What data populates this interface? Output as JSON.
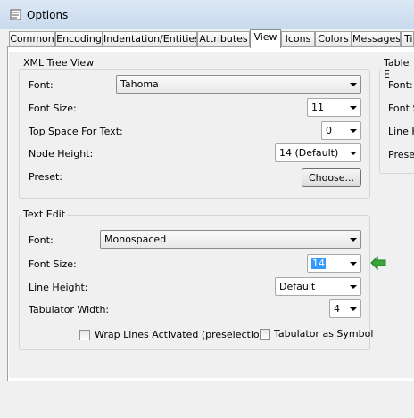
{
  "window": {
    "title": "Options"
  },
  "tabs": [
    {
      "label": "Common"
    },
    {
      "label": "Encoding"
    },
    {
      "label": "Indentation/Entities"
    },
    {
      "label": "Attributes"
    },
    {
      "label": "View"
    },
    {
      "label": "Icons"
    },
    {
      "label": "Colors"
    },
    {
      "label": "Messages"
    },
    {
      "label": "Ti"
    }
  ],
  "xml_tree_view": {
    "title": "XML Tree View",
    "font_label": "Font:",
    "font_value": "Tahoma",
    "font_size_label": "Font Size:",
    "font_size_value": "11",
    "top_space_label": "Top Space For Text:",
    "top_space_value": "0",
    "node_height_label": "Node Height:",
    "node_height_value": "14 (Default)",
    "preset_label": "Preset:",
    "choose_button": "Choose..."
  },
  "table_editor": {
    "title": "Table E",
    "font_label": "Font:",
    "font_size_label": "Font S",
    "line_height_label": "Line H",
    "preset_label": "Preset"
  },
  "text_edit": {
    "title": "Text Edit",
    "font_label": "Font:",
    "font_value": "Monospaced",
    "font_size_label": "Font Size:",
    "font_size_value": "14",
    "line_height_label": "Line Height:",
    "line_height_value": "Default",
    "tab_width_label": "Tabulator Width:",
    "tab_width_value": "4",
    "wrap_lines_label": "Wrap Lines Activated (preselection)",
    "wrap_lines_checked": false,
    "tab_symbol_label": "Tabulator as Symbol",
    "tab_symbol_checked": false
  },
  "colors": {
    "arrow": "#3aa63a",
    "selection": "#3399ff"
  }
}
